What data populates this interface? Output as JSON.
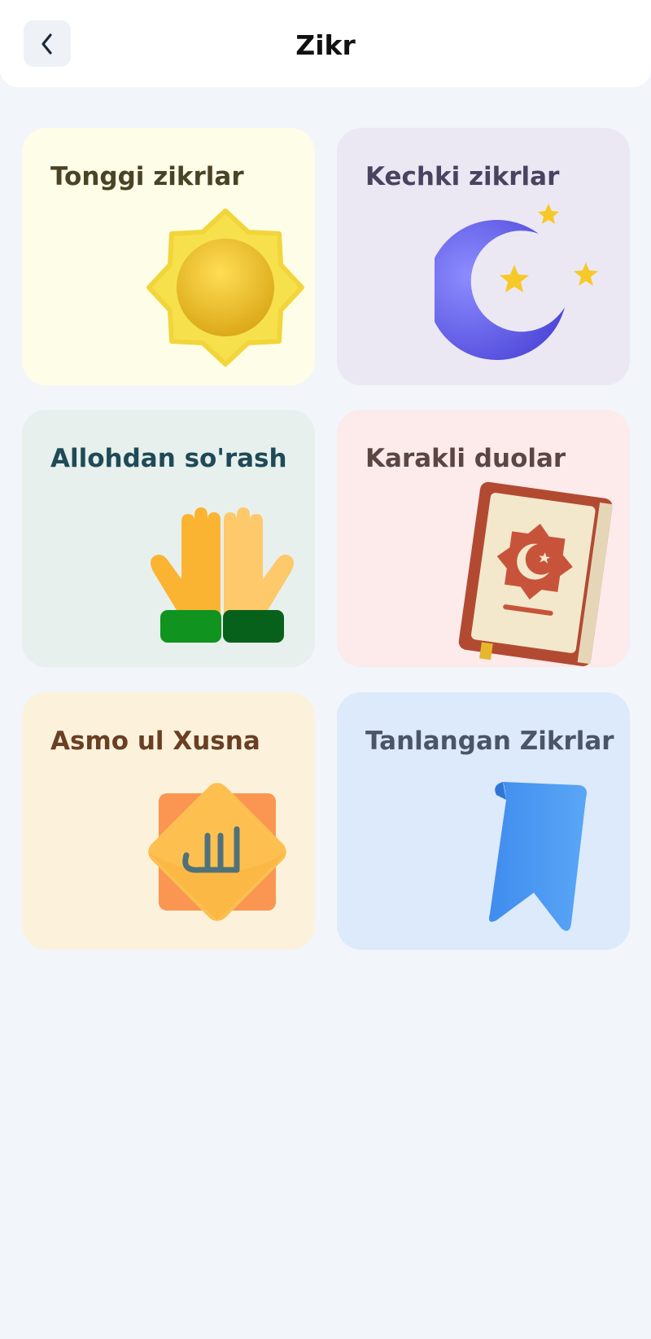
{
  "header": {
    "title": "Zikr",
    "back_icon": "chevron-left-icon"
  },
  "cards": [
    {
      "label": "Tonggi zikrlar",
      "icon": "sun-icon",
      "bg": "#fefde8",
      "text_color": "#4a4326"
    },
    {
      "label": "Kechki zikrlar",
      "icon": "crescent-moon-icon",
      "bg": "#ebe8f4",
      "text_color": "#4a4360"
    },
    {
      "label": "Allohdan so'rash",
      "icon": "praying-hands-icon",
      "bg": "#e7f0ed",
      "text_color": "#1f4a57"
    },
    {
      "label": "Karakli duolar",
      "icon": "quran-book-icon",
      "bg": "#fdeaea",
      "text_color": "#5a4744"
    },
    {
      "label": "Asmo ul Xusna",
      "icon": "allah-calligraphy-icon",
      "bg": "#fcf2dc",
      "text_color": "#6a3f24"
    },
    {
      "label": "Tanlangan Zikrlar",
      "icon": "bookmark-icon",
      "bg": "#dceafb",
      "text_color": "#4a5566"
    }
  ]
}
